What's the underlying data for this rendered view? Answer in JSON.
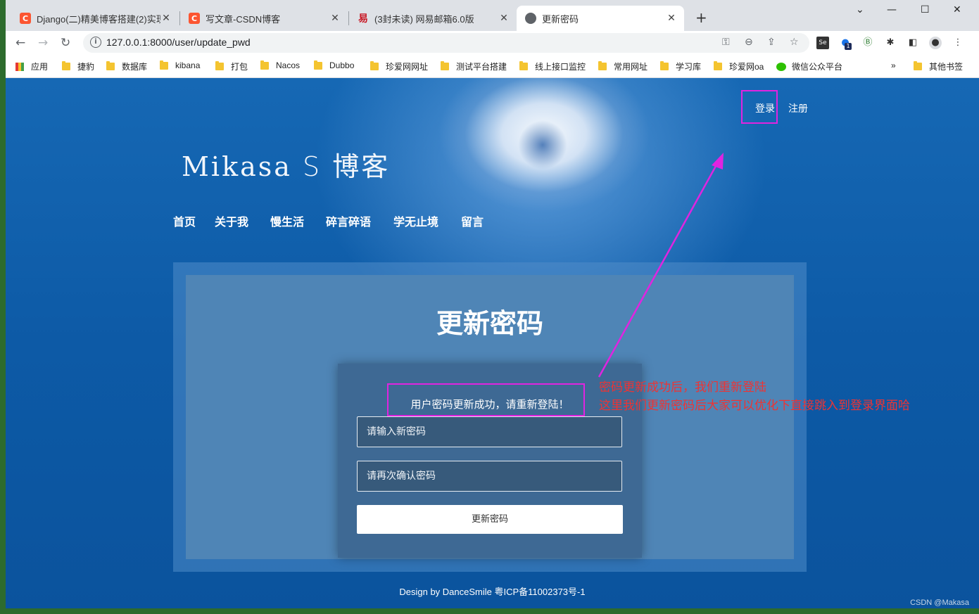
{
  "browser": {
    "tabs": [
      {
        "title": "Django(二)精美博客搭建(2)实现",
        "favicon": "C",
        "favicon_color": "#fc5531"
      },
      {
        "title": "写文章-CSDN博客",
        "favicon": "C",
        "favicon_color": "#fc5531"
      },
      {
        "title": "(3封未读) 网易邮箱6.0版",
        "favicon": "易",
        "favicon_color": "#c81623"
      },
      {
        "title": "更新密码",
        "favicon": "globe-icon",
        "favicon_color": "#5f6368"
      }
    ],
    "url": "127.0.0.1:8000/user/update_pwd",
    "bookmarks": [
      "应用",
      "捷豹",
      "数据库",
      "kibana",
      "打包",
      "Nacos",
      "Dubbo",
      "珍爱网网址",
      "测试平台搭建",
      "线上接口监控",
      "常用网址",
      "学习库",
      "珍爱网oa",
      "微信公众平台"
    ],
    "more_bookmarks": "»",
    "other_bookmarks": "其他书签",
    "ext_badge": "1"
  },
  "site": {
    "logo": "Mikasa",
    "logo_symbol": "S",
    "logo_sub": "博客",
    "nav": [
      "首页",
      "关于我",
      "慢生活",
      "碎言碎语",
      "学无止境",
      "留言"
    ],
    "login": "登录",
    "register": "注册"
  },
  "form": {
    "title": "更新密码",
    "message": "用户密码更新成功，请重新登陆！",
    "new_password_placeholder": "请输入新密码",
    "confirm_password_placeholder": "请再次确认密码",
    "submit_label": "更新密码"
  },
  "annotation": {
    "line1": "密码更新成功后，我们重新登陆",
    "line2": "这里我们更新密码后大家可以优化下直接跳入到登录界面哈"
  },
  "footer": {
    "text": "Design by DanceSmile 粤ICP备11002373号-1",
    "watermark": "CSDN @Makasa"
  },
  "colors": {
    "highlight": "#e024e0",
    "annotation": "#ee3333",
    "page_bg": "#0d5aa6"
  }
}
